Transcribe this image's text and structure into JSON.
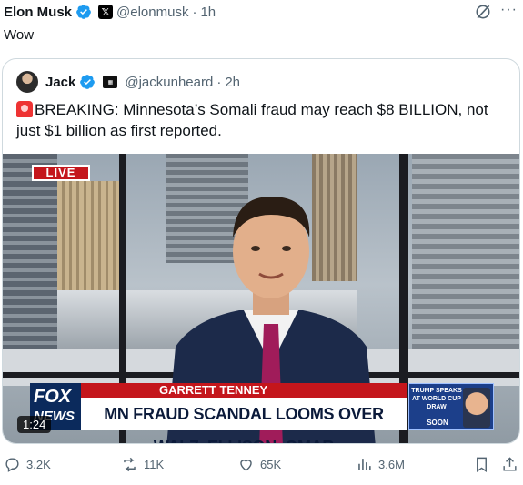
{
  "author": {
    "name": "Elon Musk",
    "handle": "@elonmusk",
    "separator": "·",
    "time": "1h"
  },
  "tweet": {
    "text": "Wow"
  },
  "quote": {
    "author": {
      "name": "Jack",
      "handle": "@jackunheard",
      "separator": "·",
      "time": "2h"
    },
    "text": "BREAKING: Minnesota’s Somali fraud may reach $8 BILLION, not just $1 billion as first reported.",
    "video": {
      "live_label": "LIVE",
      "reporter": "GARRETT TENNEY",
      "headline": "MN FRAUD SCANDAL LOOMS OVER WALZ, ELLISON, OMAR",
      "network_logo_line1": "FOX",
      "network_logo_line2": "NEWS",
      "promo_text": "TRUMP SPEAKS AT WORLD CUP DRAW",
      "promo_soon": "SOON",
      "duration": "1:24"
    }
  },
  "actions": {
    "replies": "3.2K",
    "reposts": "11K",
    "likes": "65K",
    "views": "3.6M"
  },
  "colors": {
    "verified": "#1d9bf0",
    "secondary_text": "#536471",
    "fox_red": "#c4161c",
    "fox_navy": "#0b2a5c"
  },
  "icons": [
    "verified-badge-icon",
    "x-logo-icon",
    "grok-icon",
    "more-icon",
    "siren-icon",
    "reply-icon",
    "repost-icon",
    "like-icon",
    "views-icon",
    "bookmark-icon",
    "share-icon"
  ]
}
